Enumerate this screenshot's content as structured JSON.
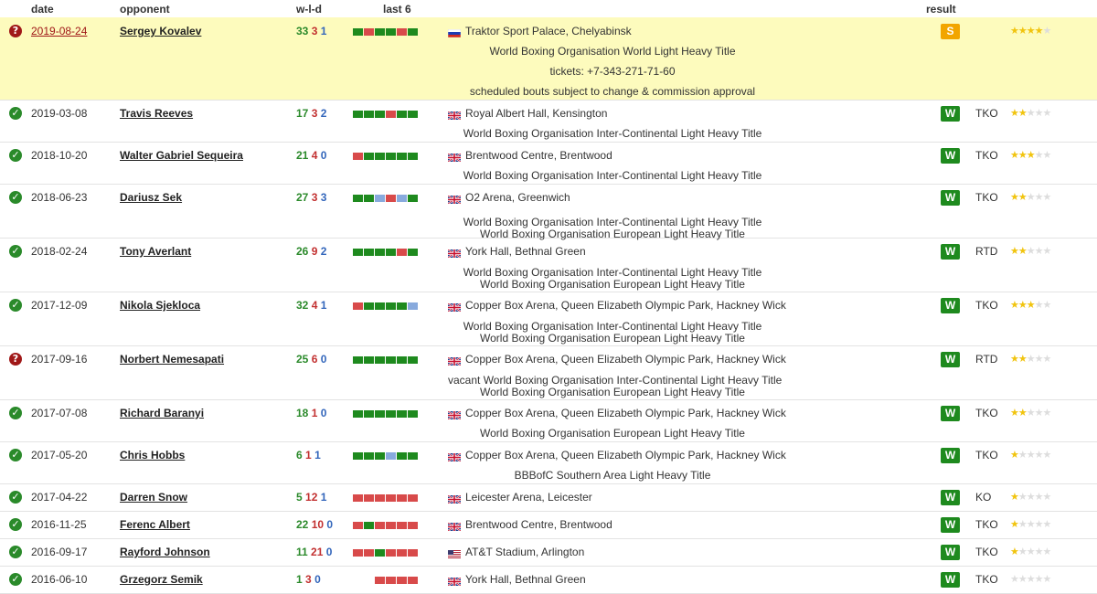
{
  "header": {
    "date": "date",
    "opponent": "opponent",
    "wld": "w-l-d",
    "last6": "last 6",
    "result": "result"
  },
  "rows": [
    {
      "status": "q",
      "date": "2019-08-24",
      "date_link": true,
      "opponent": "Sergey Kovalev",
      "w": "33",
      "l": "3",
      "d": "1",
      "last6": [
        "W",
        "L",
        "W",
        "W",
        "L",
        "W"
      ],
      "flag": "ru",
      "venue": "Traktor Sport Palace, Chelyabinsk",
      "lines": [
        "World Boxing Organisation World Light Heavy Title",
        "tickets: +7-343-271-71-60",
        "scheduled bouts subject to change & commission approval"
      ],
      "result": "S",
      "method": "",
      "stars": 4,
      "highlight": true
    },
    {
      "status": "ok",
      "date": "2019-03-08",
      "opponent": "Travis Reeves",
      "w": "17",
      "l": "3",
      "d": "2",
      "last6": [
        "W",
        "W",
        "W",
        "L",
        "W",
        "W"
      ],
      "flag": "gb",
      "venue": "Royal Albert Hall, Kensington",
      "lines": [
        "World Boxing Organisation Inter-Continental Light Heavy Title"
      ],
      "result": "W",
      "method": "TKO",
      "stars": 2
    },
    {
      "status": "ok",
      "date": "2018-10-20",
      "opponent": "Walter Gabriel Sequeira",
      "w": "21",
      "l": "4",
      "d": "0",
      "last6": [
        "L",
        "W",
        "W",
        "W",
        "W",
        "W"
      ],
      "flag": "gb",
      "venue": "Brentwood Centre, Brentwood",
      "lines": [
        "World Boxing Organisation Inter-Continental Light Heavy Title"
      ],
      "result": "W",
      "method": "TKO",
      "stars": 3
    },
    {
      "status": "ok",
      "date": "2018-06-23",
      "opponent": "Dariusz Sek",
      "w": "27",
      "l": "3",
      "d": "3",
      "last6": [
        "W",
        "W",
        "D",
        "L",
        "D",
        "W"
      ],
      "flag": "gb",
      "venue": "O2 Arena, Greenwich",
      "lines": [
        "World Boxing Organisation Inter-Continental Light Heavy Title",
        "World Boxing Organisation European Light Heavy Title"
      ],
      "result": "W",
      "method": "TKO",
      "stars": 2
    },
    {
      "status": "ok",
      "date": "2018-02-24",
      "opponent": "Tony Averlant",
      "w": "26",
      "l": "9",
      "d": "2",
      "last6": [
        "W",
        "W",
        "W",
        "W",
        "L",
        "W"
      ],
      "flag": "gb",
      "venue": "York Hall, Bethnal Green",
      "lines": [
        "World Boxing Organisation Inter-Continental Light Heavy Title",
        "World Boxing Organisation European Light Heavy Title"
      ],
      "result": "W",
      "method": "RTD",
      "stars": 2
    },
    {
      "status": "ok",
      "date": "2017-12-09",
      "opponent": "Nikola Sjekloca",
      "w": "32",
      "l": "4",
      "d": "1",
      "last6": [
        "L",
        "W",
        "W",
        "W",
        "W",
        "D"
      ],
      "flag": "gb",
      "venue": "Copper Box Arena, Queen Elizabeth Olympic Park, Hackney Wick",
      "lines": [
        "World Boxing Organisation Inter-Continental Light Heavy Title",
        "World Boxing Organisation European Light Heavy Title"
      ],
      "result": "W",
      "method": "TKO",
      "stars": 3
    },
    {
      "status": "q",
      "date": "2017-09-16",
      "opponent": "Norbert Nemesapati",
      "w": "25",
      "l": "6",
      "d": "0",
      "last6": [
        "W",
        "W",
        "W",
        "W",
        "W",
        "W"
      ],
      "flag": "gb",
      "venue": "Copper Box Arena, Queen Elizabeth Olympic Park, Hackney Wick",
      "lines": [
        "vacant World Boxing Organisation Inter-Continental Light Heavy Title",
        "World Boxing Organisation European Light Heavy Title"
      ],
      "result": "W",
      "method": "RTD",
      "stars": 2
    },
    {
      "status": "ok",
      "date": "2017-07-08",
      "opponent": "Richard Baranyi",
      "w": "18",
      "l": "1",
      "d": "0",
      "last6": [
        "W",
        "W",
        "W",
        "W",
        "W",
        "W"
      ],
      "flag": "gb",
      "venue": "Copper Box Arena, Queen Elizabeth Olympic Park, Hackney Wick",
      "lines": [
        "World Boxing Organisation European Light Heavy Title"
      ],
      "result": "W",
      "method": "TKO",
      "stars": 2
    },
    {
      "status": "ok",
      "date": "2017-05-20",
      "opponent": "Chris Hobbs",
      "w": "6",
      "l": "1",
      "d": "1",
      "last6": [
        "W",
        "W",
        "W",
        "D",
        "W",
        "W"
      ],
      "flag": "gb",
      "venue": "Copper Box Arena, Queen Elizabeth Olympic Park, Hackney Wick",
      "lines": [
        "BBBofC Southern Area Light Heavy Title"
      ],
      "result": "W",
      "method": "TKO",
      "stars": 1
    },
    {
      "status": "ok",
      "date": "2017-04-22",
      "opponent": "Darren Snow",
      "w": "5",
      "l": "12",
      "d": "1",
      "last6": [
        "L",
        "L",
        "L",
        "L",
        "L",
        "L"
      ],
      "flag": "gb",
      "venue": "Leicester Arena, Leicester",
      "lines": [],
      "result": "W",
      "method": "KO",
      "stars": 1
    },
    {
      "status": "ok",
      "date": "2016-11-25",
      "opponent": "Ferenc Albert",
      "w": "22",
      "l": "10",
      "d": "0",
      "last6": [
        "L",
        "W",
        "L",
        "L",
        "L",
        "L"
      ],
      "flag": "gb",
      "venue": "Brentwood Centre, Brentwood",
      "lines": [],
      "result": "W",
      "method": "TKO",
      "stars": 1
    },
    {
      "status": "ok",
      "date": "2016-09-17",
      "opponent": "Rayford Johnson",
      "w": "11",
      "l": "21",
      "d": "0",
      "last6": [
        "L",
        "L",
        "W",
        "L",
        "L",
        "L"
      ],
      "flag": "us",
      "venue": "AT&T Stadium, Arlington",
      "lines": [],
      "result": "W",
      "method": "TKO",
      "stars": 1
    },
    {
      "status": "ok",
      "date": "2016-06-10",
      "opponent": "Grzegorz Semik",
      "w": "1",
      "l": "3",
      "d": "0",
      "last6": [
        "",
        "",
        "L",
        "L",
        "L",
        "L"
      ],
      "flag": "gb",
      "venue": "York Hall, Bethnal Green",
      "lines": [],
      "result": "W",
      "method": "TKO",
      "stars": 0
    }
  ]
}
